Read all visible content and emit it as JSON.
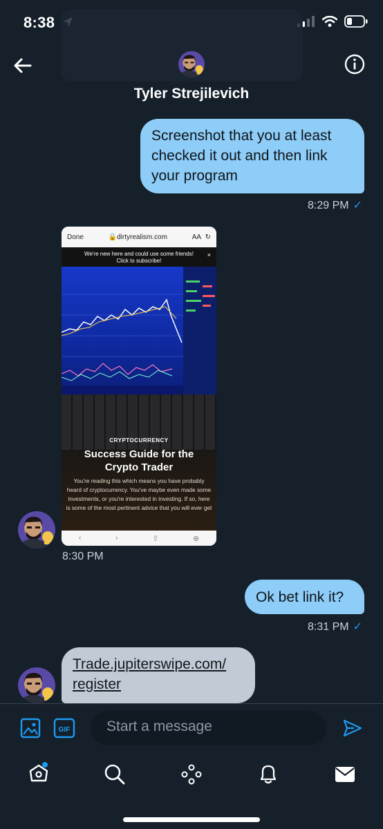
{
  "status": {
    "time": "8:38"
  },
  "header": {
    "contact_name": "Tyler Strejilevich"
  },
  "messages": [
    {
      "direction": "sent",
      "text": "Screenshot that you at least checked it out and then link your program",
      "time": "8:29 PM",
      "read_mark": "✓"
    },
    {
      "direction": "received",
      "type": "image",
      "time": "8:30 PM"
    },
    {
      "direction": "sent",
      "text": "Ok bet link it?",
      "time": "8:31 PM",
      "read_mark": "✓"
    },
    {
      "direction": "received",
      "line1": "Trade.jupiterswipe.com/",
      "line2": "register"
    }
  ],
  "shared_image": {
    "done": "Done",
    "url": "dirtyrealism.com",
    "text_size": "AA",
    "banner_line1": "We're new here and could use some friends!",
    "banner_line2": "Click to subscribe!",
    "close": "×",
    "category": "CRYPTOCURRENCY",
    "headline_line1": "Success Guide for the",
    "headline_line2": "Crypto Trader",
    "body": "You're reading this which means you have probably heard of cryptocurrency. You've maybe even made some investments, or you're interested in investing. If so, here is some of the most pertinent advice that you will ever get"
  },
  "composer": {
    "placeholder": "Start a message"
  },
  "colors": {
    "background": "#15202b",
    "sent_bubble": "#8ecdf8",
    "received_bubble": "#c0cbd6",
    "accent": "#1d9bf0"
  },
  "icons": [
    "back-arrow-icon",
    "info-icon",
    "image-icon",
    "gif-icon",
    "send-icon",
    "home-icon",
    "search-icon",
    "spaces-icon",
    "notifications-icon",
    "messages-icon"
  ]
}
